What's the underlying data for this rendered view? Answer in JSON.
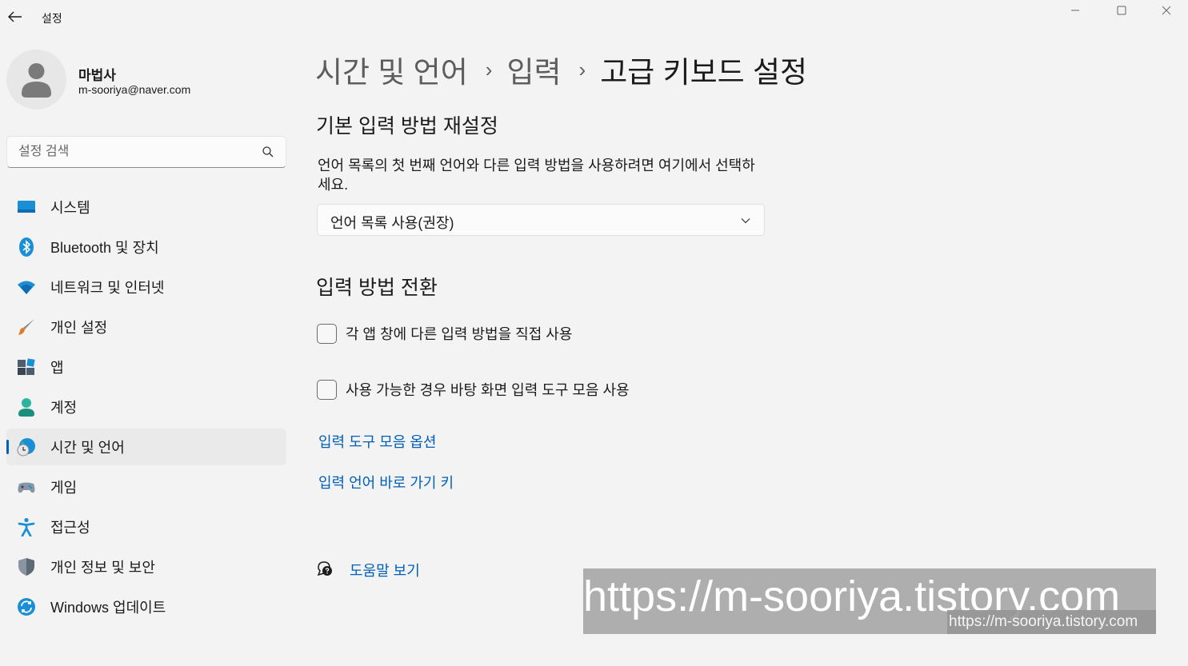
{
  "window": {
    "title": "설정"
  },
  "profile": {
    "name": "마법사",
    "email": "m-sooriya@naver.com"
  },
  "search": {
    "placeholder": "설정 검색"
  },
  "nav": {
    "items": [
      {
        "label": "시스템",
        "icon": "system-icon"
      },
      {
        "label": "Bluetooth 및 장치",
        "icon": "bluetooth-icon"
      },
      {
        "label": "네트워크 및 인터넷",
        "icon": "wifi-icon"
      },
      {
        "label": "개인 설정",
        "icon": "paintbrush-icon"
      },
      {
        "label": "앱",
        "icon": "apps-icon"
      },
      {
        "label": "계정",
        "icon": "account-icon"
      },
      {
        "label": "시간 및 언어",
        "icon": "time-language-icon",
        "active": true
      },
      {
        "label": "게임",
        "icon": "gamepad-icon"
      },
      {
        "label": "접근성",
        "icon": "accessibility-icon"
      },
      {
        "label": "개인 정보 및 보안",
        "icon": "shield-icon"
      },
      {
        "label": "Windows 업데이트",
        "icon": "update-icon"
      }
    ]
  },
  "breadcrumb": {
    "items": [
      "시간 및 언어",
      "입력",
      "고급 키보드 설정"
    ],
    "separator": "›"
  },
  "override_section": {
    "title": "기본 입력 방법 재설정",
    "description": "언어 목록의 첫 번째 언어와 다른 입력 방법을 사용하려면 여기에서 선택하세요.",
    "dropdown_value": "언어 목록 사용(권장)"
  },
  "switching_section": {
    "title": "입력 방법 전환",
    "checkbox_per_app": "각 앱 창에 다른 입력 방법을 직접 사용",
    "checkbox_language_bar": "사용 가능한 경우 바탕 화면 입력 도구 모음 사용",
    "link_language_bar_options": "입력 도구 모음 옵션",
    "link_hotkeys": "입력 언어 바로 가기 키"
  },
  "help": {
    "label": "도움말 보기"
  },
  "watermark": {
    "text": "https://m-sooriya.tistory.com"
  },
  "colors": {
    "accent": "#005fb8",
    "background": "#f3f3f3"
  }
}
